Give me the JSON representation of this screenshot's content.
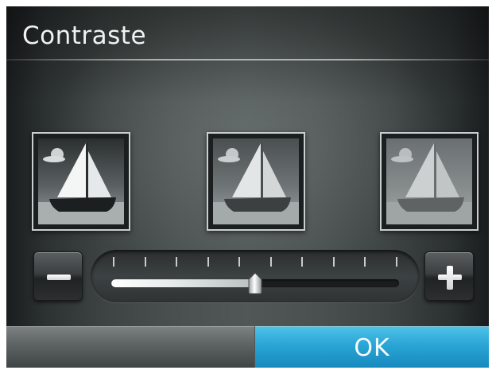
{
  "screen": {
    "title": "Contraste"
  },
  "previews": [
    {
      "level": "low",
      "icon": "sailboat-image-icon"
    },
    {
      "level": "medium",
      "icon": "sailboat-image-icon"
    },
    {
      "level": "high",
      "icon": "sailboat-image-icon"
    }
  ],
  "contrast_slider": {
    "value_fraction": 0.5,
    "tick_count": 10,
    "decrease_icon": "minus-icon",
    "increase_icon": "plus-icon"
  },
  "footer": {
    "ok_label": "OK"
  },
  "colors": {
    "accent": "#2aa5d6",
    "background": "#3d4342",
    "footer_left": "#5d6263",
    "text": "#eef2f2"
  }
}
